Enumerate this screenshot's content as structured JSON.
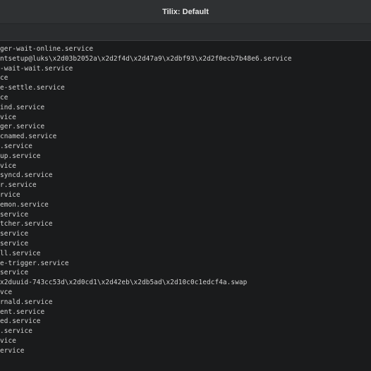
{
  "window": {
    "title": "Tilix: Default"
  },
  "terminal": {
    "lines": [
      "ger-wait-online.service",
      "ntsetup@luks\\x2d03b2052a\\x2d2f4d\\x2d47a9\\x2dbf93\\x2d2f0ecb7b48e6.service",
      "-wait-wait.service",
      "ce",
      "e-settle.service",
      "ce",
      "ind.service",
      "vice",
      "ger.service",
      "cnamed.service",
      ".service",
      "up.service",
      "vice",
      "syncd.service",
      "r.service",
      "rvice",
      "emon.service",
      "service",
      "tcher.service",
      "service",
      "service",
      "ll.service",
      "e-trigger.service",
      "service",
      "x2duuid-743cc53d\\x2d0cd1\\x2d42eb\\x2db5ad\\x2d10c0c1edcf4a.swap",
      "vce",
      "rnald.service",
      "ent.service",
      "ed.service",
      ".service",
      "vice",
      "ervice"
    ]
  }
}
